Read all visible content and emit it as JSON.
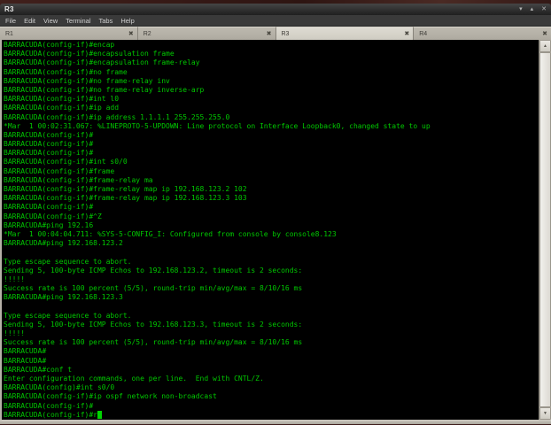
{
  "window": {
    "title": "R3",
    "controls": {
      "minimize": "▾",
      "maximize": "▴",
      "close": "✕"
    }
  },
  "menubar": {
    "items": [
      "File",
      "Edit",
      "View",
      "Terminal",
      "Tabs",
      "Help"
    ]
  },
  "tabbar": {
    "close_glyph": "✖",
    "tabs": [
      {
        "label": "R1",
        "active": false
      },
      {
        "label": "R2",
        "active": false
      },
      {
        "label": "R3",
        "active": true
      },
      {
        "label": "R4",
        "active": false
      }
    ]
  },
  "scrollbar": {
    "up_glyph": "▲",
    "down_glyph": "▼"
  },
  "colors": {
    "terminal_bg": "#000000",
    "terminal_text": "#00c800",
    "titlebar_bg": "#2e2e2e",
    "active_tab_bg": "#d8d5cb",
    "inactive_tab_bg": "#b3afa5",
    "desktop_bg": "#3d1c1a"
  },
  "terminal": {
    "cursor_line_index": 41,
    "lines": [
      "BARRACUDA(config-if)#encap",
      "BARRACUDA(config-if)#encapsulation frame",
      "BARRACUDA(config-if)#encapsulation frame-relay",
      "BARRACUDA(config-if)#no frame",
      "BARRACUDA(config-if)#no frame-relay inv",
      "BARRACUDA(config-if)#no frame-relay inverse-arp",
      "BARRACUDA(config-if)#int l0",
      "BARRACUDA(config-if)#ip add",
      "BARRACUDA(config-if)#ip address 1.1.1.1 255.255.255.0",
      "*Mar  1 00:02:31.067: %LINEPROTO-5-UPDOWN: Line protocol on Interface Loopback0, changed state to up",
      "BARRACUDA(config-if)#",
      "BARRACUDA(config-if)#",
      "BARRACUDA(config-if)#",
      "BARRACUDA(config-if)#int s0/0",
      "BARRACUDA(config-if)#frame",
      "BARRACUDA(config-if)#frame-relay ma",
      "BARRACUDA(config-if)#frame-relay map ip 192.168.123.2 102",
      "BARRACUDA(config-if)#frame-relay map ip 192.168.123.3 103",
      "BARRACUDA(config-if)#",
      "BARRACUDA(config-if)#^Z",
      "BARRACUDA#ping 192.16",
      "*Mar  1 00:04:04.711: %SYS-5-CONFIG_I: Configured from console by console8.123",
      "BARRACUDA#ping 192.168.123.2",
      "",
      "Type escape sequence to abort.",
      "Sending 5, 100-byte ICMP Echos to 192.168.123.2, timeout is 2 seconds:",
      "!!!!!",
      "Success rate is 100 percent (5/5), round-trip min/avg/max = 8/10/16 ms",
      "BARRACUDA#ping 192.168.123.3",
      "",
      "Type escape sequence to abort.",
      "Sending 5, 100-byte ICMP Echos to 192.168.123.3, timeout is 2 seconds:",
      "!!!!!",
      "Success rate is 100 percent (5/5), round-trip min/avg/max = 8/10/16 ms",
      "BARRACUDA#",
      "BARRACUDA#",
      "BARRACUDA#conf t",
      "Enter configuration commands, one per line.  End with CNTL/Z.",
      "BARRACUDA(config)#int s0/0",
      "BARRACUDA(config-if)#ip ospf network non-broadcast",
      "BARRACUDA(config-if)#",
      "BARRACUDA(config-if)#r"
    ]
  }
}
